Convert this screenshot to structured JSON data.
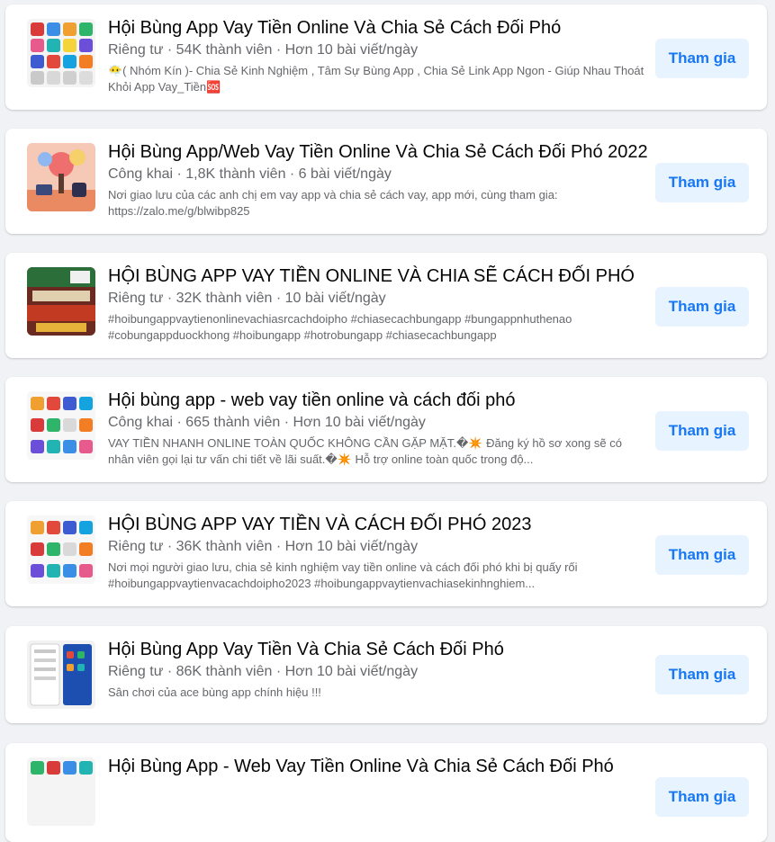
{
  "groups": [
    {
      "name": "Hội Bùng App Vay Tiền Online Và Chia Sẻ Cách Đối Phó",
      "meta": "Riêng tư · 54K thành viên · Hơn 10 bài viết/ngày",
      "description": "😶‍🌫️( Nhóm Kín )- Chia Sẻ Kinh Nghiệm , Tâm Sự Bùng App , Chia Sẻ Link App Ngon - Giúp Nhau Thoát Khỏi App Vay_Tiền🆘",
      "join_label": "Tham gia",
      "thumb_icon": "app-grid-icon"
    },
    {
      "name": "Hội Bùng App/Web Vay Tiền Online Và Chia Sẻ Cách Đối Phó 2022",
      "meta": "Công khai · 1,8K thành viên · 6 bài viết/ngày",
      "description": "Nơi giao lưu của các anh chị em vay app và chia sẻ cách vay, app mới, cùng tham gia: https://zalo.me/g/blwibp825",
      "join_label": "Tham gia",
      "thumb_icon": "illustration-icon"
    },
    {
      "name": "HỘI BÙNG APP VAY TIỀN ONLINE VÀ CHIA SẼ CÁCH ĐỐI PHÓ",
      "meta": "Riêng tư · 32K thành viên · 10 bài viết/ngày",
      "description": "#hoibungappvaytienonlinevachiasrcachdoipho #chiasecachbungapp #bungappnhuthenao #cobungappduockhong #hoibungapp #hotrobungapp #chiasecachbungapp",
      "join_label": "Tham gia",
      "thumb_icon": "photo-collage-icon"
    },
    {
      "name": "Hội bùng app - web vay tiền online và cách đối phó",
      "meta": "Công khai · 665 thành viên · Hơn 10 bài viết/ngày",
      "description": "VAY TIỀN NHANH ONLINE TOÀN QUỐC KHÔNG CẦN GẶP MẶT.�✴️ Đăng ký hồ sơ xong sẽ có nhân viên gọi lại tư vấn chi tiết về lãi suất.�✴️ Hỗ trợ online toàn quốc trong độ...",
      "join_label": "Tham gia",
      "thumb_icon": "app-grid-icon"
    },
    {
      "name": "HỘI BÙNG APP VAY TIỀN VÀ CÁCH ĐỐI PHÓ 2023",
      "meta": "Riêng tư · 36K thành viên · Hơn 10 bài viết/ngày",
      "description": "Nơi mọi người giao lưu, chia sẻ kinh nghiệm vay tiền online và cách đối phó khi bị quấy rối #hoibungappvaytienvacachdoipho2023 #hoibungappvaytienvachiasekinhnghiem...",
      "join_label": "Tham gia",
      "thumb_icon": "app-grid-icon"
    },
    {
      "name": "Hội Bùng App Vay Tiền Và Chia Sẻ Cách Đối Phó",
      "meta": "Riêng tư · 86K thành viên · Hơn 10 bài viết/ngày",
      "description": "Sân chơi của ace bùng app chính hiệu !!!",
      "join_label": "Tham gia",
      "thumb_icon": "phone-screenshot-icon"
    },
    {
      "name": "Hội Bùng App - Web Vay Tiền Online Và Chia Sẻ Cách Đối Phó",
      "meta": "",
      "description": "",
      "join_label": "Tham gia",
      "thumb_icon": "app-grid-icon"
    }
  ],
  "colors": {
    "page_bg": "#f0f2f5",
    "card_bg": "#ffffff",
    "button_bg": "#e7f3ff",
    "button_text": "#1877f2",
    "meta_text": "#65676b"
  }
}
